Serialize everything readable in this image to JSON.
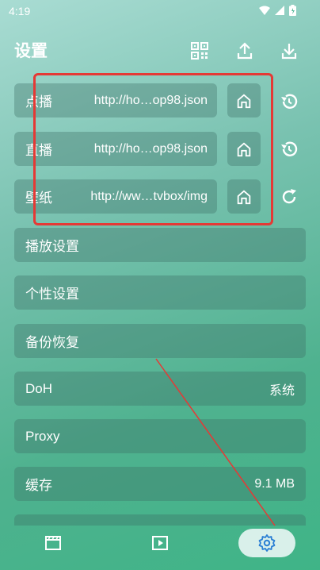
{
  "status": {
    "time": "4:19"
  },
  "header": {
    "title": "设置"
  },
  "sources": [
    {
      "label": "点播",
      "url": "http://ho…op98.json",
      "side_icon": "history-icon"
    },
    {
      "label": "直播",
      "url": "http://ho…op98.json",
      "side_icon": "history-icon"
    },
    {
      "label": "壁纸",
      "url": "http://ww…tvbox/img",
      "side_icon": "refresh-icon"
    }
  ],
  "settings": {
    "playback": "播放设置",
    "personal": "个性设置",
    "backup": "备份恢复",
    "doh_label": "DoH",
    "doh_value": "系统",
    "proxy_label": "Proxy",
    "cache_label": "缓存",
    "cache_value": "9.1 MB"
  },
  "colors": {
    "annotation": "#e53935",
    "nav_active_bg": "#d9f0ea",
    "active_icon": "#2a7fd4"
  }
}
